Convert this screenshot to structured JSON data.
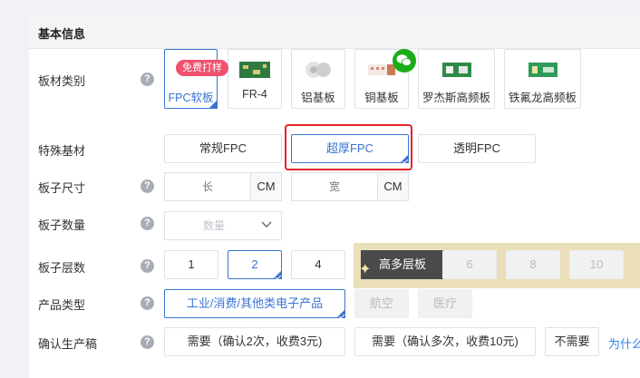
{
  "section": {
    "title": "基本信息"
  },
  "rows": {
    "material": {
      "label": "板材类别",
      "help": "?"
    },
    "special": {
      "label": "特殊基材"
    },
    "size": {
      "label": "板子尺寸",
      "help": "?"
    },
    "qty": {
      "label": "板子数量",
      "help": "?"
    },
    "layers": {
      "label": "板子层数",
      "help": "?"
    },
    "product": {
      "label": "产品类型",
      "help": "?"
    },
    "confirm": {
      "label": "确认生产稿",
      "help": "?"
    }
  },
  "materials": [
    {
      "label": "FPC软板",
      "selected": true
    },
    {
      "label": "FR-4"
    },
    {
      "label": "铝基板"
    },
    {
      "label": "铜基板"
    },
    {
      "label": "罗杰斯高频板"
    },
    {
      "label": "铁氟龙高频板"
    }
  ],
  "badge": "免费打样",
  "special_opts": [
    "常规FPC",
    "超厚FPC",
    "透明FPC"
  ],
  "size": {
    "length_placeholder": "长",
    "width_placeholder": "宽",
    "unit": "CM"
  },
  "qty": {
    "placeholder": "数量"
  },
  "layers": {
    "opts": [
      "1",
      "2",
      "4"
    ],
    "multi": "高多层板",
    "multi_opts": [
      "6",
      "8",
      "10"
    ]
  },
  "product": {
    "opts": [
      "工业/消费/其他类电子产品",
      "航空",
      "医疗"
    ]
  },
  "confirm": {
    "opts": [
      "需要（确认2次，收费3元)",
      "需要（确认多次，收费10元)",
      "不需要"
    ],
    "link": "为什么"
  },
  "colors": {
    "accent": "#3a73d1",
    "highlight": "#e2242a",
    "badge": "#f0506e",
    "wechat": "#1aad19"
  }
}
